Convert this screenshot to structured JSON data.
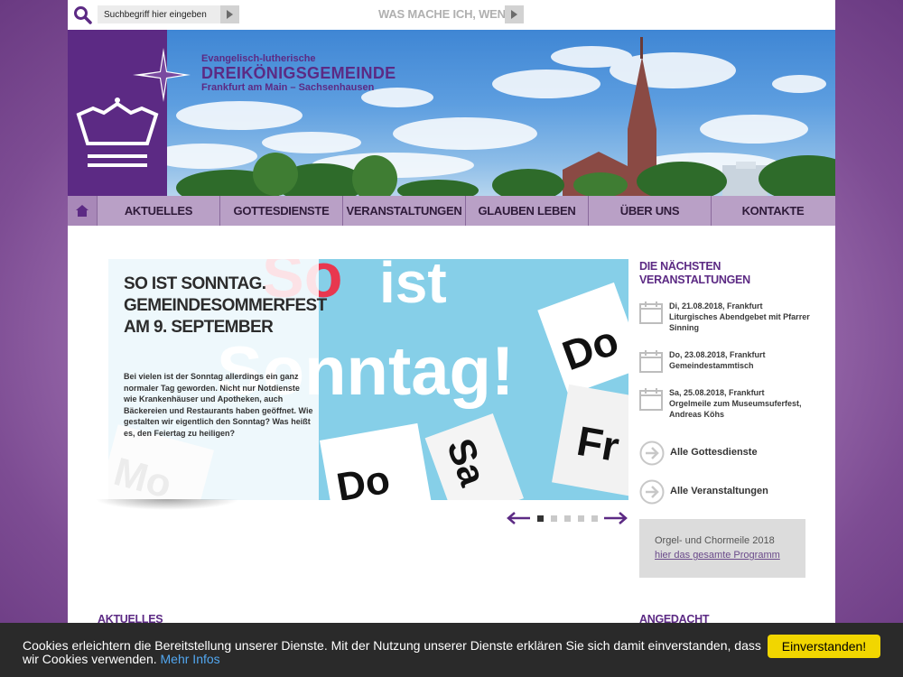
{
  "topbar": {
    "search_placeholder": "Suchbegriff hier eingeben",
    "wasmache_label": "WAS MACHE ICH, WENN..."
  },
  "header": {
    "logo_line1": "Evangelisch-lutherische",
    "logo_line2": "DREIKÖNIGSGEMEINDE",
    "logo_line3": "Frankfurt am Main – Sachsenhausen"
  },
  "nav": {
    "items": [
      {
        "label": "AKTUELLES"
      },
      {
        "label": "GOTTESDIENSTE"
      },
      {
        "label": "VERANSTALTUNGEN"
      },
      {
        "label": "GLAUBEN LEBEN"
      },
      {
        "label": "ÜBER UNS"
      },
      {
        "label": "KONTAKTE"
      }
    ]
  },
  "slider": {
    "title_line1": "SO IST SONNTAG.",
    "title_line2": "GEMEINDESOMMERFEST",
    "title_line3": "AM 9. SEPTEMBER",
    "text": "Bei vielen ist der Sonntag allerdings ein ganz normaler Tag geworden. Nicht nur Notdienste wie Krankenhäuser und Apotheken, auch Bäckereien und Restaurants haben geöffnet. Wie gestalten wir eigentlich den Sonntag? Was heißt es, den Feiertag zu heiligen?",
    "bg_word1": "So",
    "bg_word2": "ist",
    "bg_word3": "Sonntag!",
    "card_mo": "Mo",
    "card_do": "Do",
    "card_fr": "Fr",
    "card_do2": "Do",
    "card_sa": "Sa",
    "dots": 5,
    "active_dot": 0
  },
  "sidebar": {
    "heading": "DIE NÄCHSTEN VERANSTALTUNGEN",
    "events": [
      {
        "date": "Di, 21.08.2018, Frankfurt",
        "title": "Liturgisches Abendgebet mit Pfarrer Sinning"
      },
      {
        "date": "Do, 23.08.2018, Frankfurt",
        "title": "Gemeindestammtisch"
      },
      {
        "date": "Sa, 25.08.2018, Frankfurt",
        "title": "Orgelmeile zum Museumsuferfest, Andreas Köhs"
      }
    ],
    "links": [
      {
        "label": "Alle Gottesdienste"
      },
      {
        "label": "Alle Veranstaltungen"
      }
    ],
    "infobox": {
      "title": "Orgel- und Chormeile 2018",
      "link": "hier das gesamte Programm"
    }
  },
  "sections": {
    "left": "AKTUELLES",
    "right": "ANGEDACHT"
  },
  "cookie": {
    "text": "Cookies erleichtern die Bereitstellung unserer Dienste. Mit der Nutzung unserer Dienste erklären Sie sich damit einverstanden, dass wir Cookies verwenden. ",
    "link": "Mehr Infos",
    "button": "Einverstanden!"
  },
  "colors": {
    "brand_purple": "#5c2a84",
    "nav_bg": "#b9a0c6",
    "cookie_button": "#f1d600"
  }
}
